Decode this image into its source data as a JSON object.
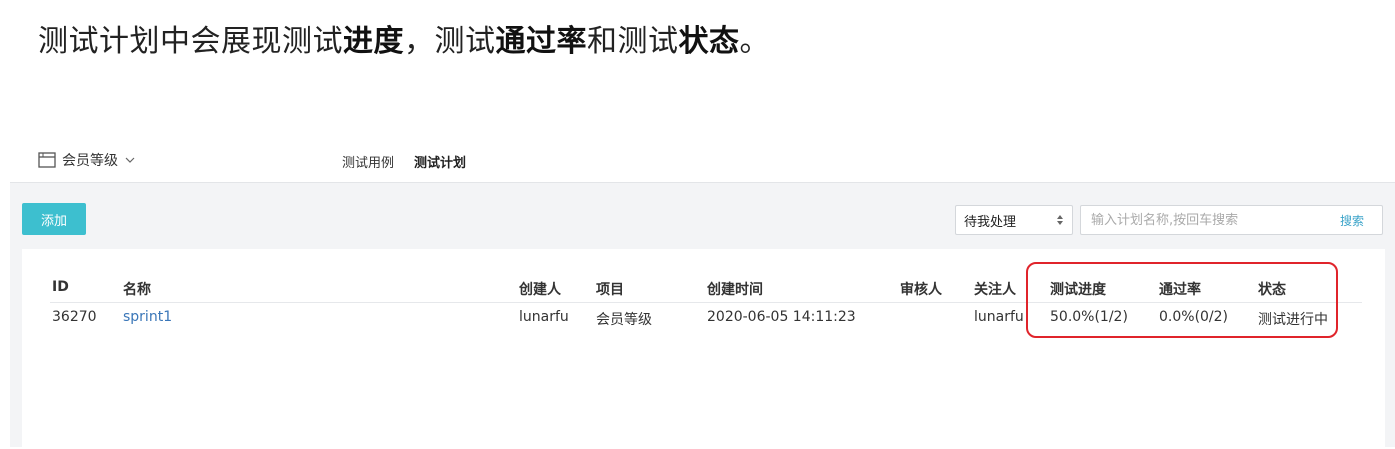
{
  "caption": {
    "part1": "测试计划中会展现测试",
    "b1": "进度",
    "part2": "，测试",
    "b2": "通过率",
    "part3": "和测试",
    "b3": "状态",
    "part4": "。"
  },
  "project": {
    "name": "会员等级",
    "icon": "project-icon"
  },
  "tabs": [
    {
      "label": "测试用例",
      "active": false
    },
    {
      "label": "测试计划",
      "active": true
    }
  ],
  "toolbar": {
    "add_label": "添加",
    "filter_value": "待我处理",
    "search_placeholder": "输入计划名称,按回车搜索",
    "search_label": "搜索"
  },
  "table": {
    "columns": [
      "ID",
      "名称",
      "创建人",
      "项目",
      "创建时间",
      "审核人",
      "关注人",
      "测试进度",
      "通过率",
      "状态"
    ],
    "rows": [
      {
        "id": "36270",
        "name": "sprint1",
        "creator": "lunarfu",
        "project": "会员等级",
        "created_at": "2020-06-05 14:11:23",
        "reviewer": "",
        "follower": "lunarfu",
        "progress": "50.0%(1/2)",
        "pass_rate": "0.0%(0/2)",
        "status": "测试进行中"
      }
    ]
  },
  "colors": {
    "accent": "#3dbfcf",
    "link": "#3a76b8",
    "highlight": "#e0242b"
  }
}
